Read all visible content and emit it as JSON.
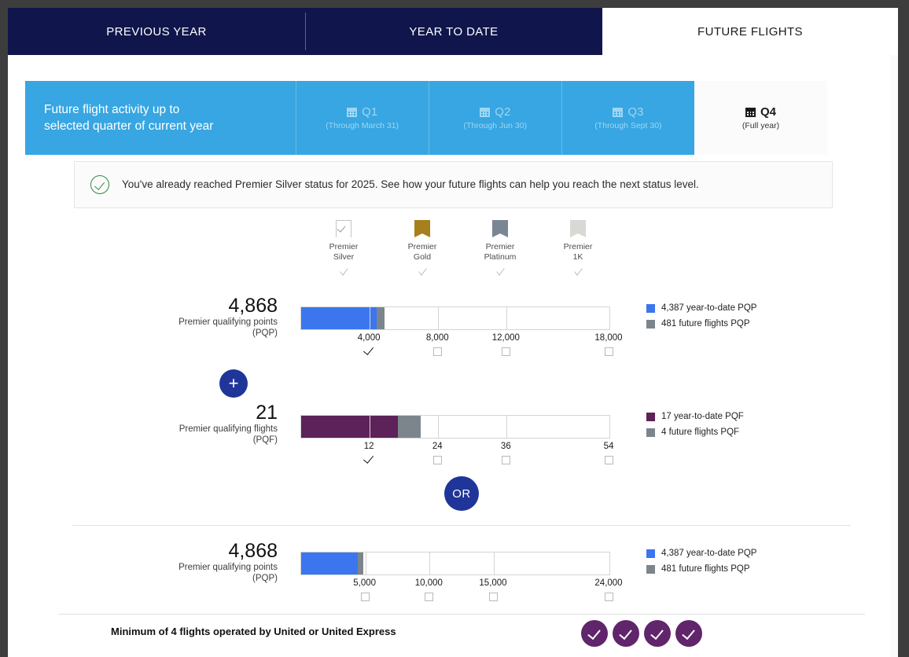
{
  "tabs": [
    {
      "label": "PREVIOUS YEAR",
      "active": false
    },
    {
      "label": "YEAR TO DATE",
      "active": false
    },
    {
      "label": "FUTURE FLIGHTS",
      "active": true
    }
  ],
  "quarter_selector": {
    "intro_line1": "Future flight activity up to",
    "intro_line2": "selected quarter of current year",
    "quarters": [
      {
        "label": "Q1",
        "sub": "(Through March 31)",
        "selected": false,
        "icon": "calendar-icon"
      },
      {
        "label": "Q2",
        "sub": "(Through Jun 30)",
        "selected": false,
        "icon": "calendar-icon"
      },
      {
        "label": "Q3",
        "sub": "(Through Sept 30)",
        "selected": false,
        "icon": "calendar-icon"
      },
      {
        "label": "Q4",
        "sub": "(Full year)",
        "selected": true,
        "icon": "calendar-icon"
      }
    ]
  },
  "notice": {
    "icon": "check-circle-icon",
    "text": "You've already reached Premier Silver status for 2025. See how your future flights can help you reach the next status level."
  },
  "tiers": [
    {
      "line1": "Premier",
      "line2": "Silver",
      "color": "#ffffff",
      "style": "outline-check",
      "icon": "ribbon-icon"
    },
    {
      "line1": "Premier",
      "line2": "Gold",
      "color": "#a5801c",
      "style": "solid",
      "icon": "ribbon-icon"
    },
    {
      "line1": "Premier",
      "line2": "Platinum",
      "color": "#7b8694",
      "style": "solid",
      "icon": "ribbon-icon"
    },
    {
      "line1": "Premier",
      "line2": "1K",
      "color": "#d8d8d5",
      "style": "solid",
      "icon": "ribbon-icon"
    }
  ],
  "colors": {
    "pqp_ytd": "#3b76ee",
    "pqp_future": "#7d858c",
    "pqf_ytd": "#5c2259",
    "pqf_future": "#7d858c",
    "accent_navy": "#10164b",
    "accent_blue": "#37a6e2",
    "button_blue": "#1f3599",
    "purple_dot": "#60256a"
  },
  "plus_button_label": "+",
  "or_button_label": "OR",
  "metrics": [
    {
      "id": "pqp-primary",
      "value": "4,868",
      "caption_line1": "Premier qualifying points",
      "caption_line2": "(PQP)",
      "ticks": [
        {
          "label": "4,000",
          "checked": true
        },
        {
          "label": "8,000",
          "checked": false
        },
        {
          "label": "12,000",
          "checked": false
        },
        {
          "label": "18,000",
          "checked": false
        }
      ],
      "legend": [
        {
          "text": "4,387 year-to-date PQP",
          "color": "#3b76ee"
        },
        {
          "text": "481 future flights PQP",
          "color": "#7d858c"
        }
      ]
    },
    {
      "id": "pqf",
      "value": "21",
      "caption_line1": "Premier qualifying flights",
      "caption_line2": "(PQF)",
      "ticks": [
        {
          "label": "12",
          "checked": true
        },
        {
          "label": "24",
          "checked": false
        },
        {
          "label": "36",
          "checked": false
        },
        {
          "label": "54",
          "checked": false
        }
      ],
      "legend": [
        {
          "text": "17 year-to-date PQF",
          "color": "#5c2259"
        },
        {
          "text": "4 future flights PQF",
          "color": "#7d858c"
        }
      ]
    },
    {
      "id": "pqp-alternate",
      "value": "4,868",
      "caption_line1": "Premier qualifying points",
      "caption_line2": "(PQP)",
      "ticks": [
        {
          "label": "5,000",
          "checked": false
        },
        {
          "label": "10,000",
          "checked": false
        },
        {
          "label": "15,000",
          "checked": false
        },
        {
          "label": "24,000",
          "checked": false
        }
      ],
      "legend": [
        {
          "text": "4,387 year-to-date PQP",
          "color": "#3b76ee"
        },
        {
          "text": "481 future flights PQP",
          "color": "#7d858c"
        }
      ]
    }
  ],
  "footer": {
    "min_flights_text": "Minimum of 4 flights operated by United or United Express",
    "completed_dots": 4
  },
  "chart_data": [
    {
      "type": "bar",
      "title": "Premier qualifying points (PQP)",
      "orientation": "horizontal-stacked",
      "total": 4868,
      "series": [
        {
          "name": "year-to-date PQP",
          "value": 4387,
          "color": "#3b76ee"
        },
        {
          "name": "future flights PQP",
          "value": 481,
          "color": "#7d858c"
        }
      ],
      "tick_values": [
        4000,
        8000,
        12000,
        18000
      ],
      "tick_labels": [
        "4,000",
        "8,000",
        "12,000",
        "18,000"
      ],
      "tick_checked": [
        true,
        false,
        false,
        false
      ],
      "xlim": [
        0,
        18000
      ],
      "grid": true,
      "legend_position": "right"
    },
    {
      "type": "bar",
      "title": "Premier qualifying flights (PQF)",
      "orientation": "horizontal-stacked",
      "total": 21,
      "series": [
        {
          "name": "year-to-date PQF",
          "value": 17,
          "color": "#5c2259"
        },
        {
          "name": "future flights PQF",
          "value": 4,
          "color": "#7d858c"
        }
      ],
      "tick_values": [
        12,
        24,
        36,
        54
      ],
      "tick_labels": [
        "12",
        "24",
        "36",
        "54"
      ],
      "tick_checked": [
        true,
        false,
        false,
        false
      ],
      "xlim": [
        0,
        54
      ],
      "grid": true,
      "legend_position": "right"
    },
    {
      "type": "bar",
      "title": "Premier qualifying points (PQP)",
      "orientation": "horizontal-stacked",
      "total": 4868,
      "series": [
        {
          "name": "year-to-date PQP",
          "value": 4387,
          "color": "#3b76ee"
        },
        {
          "name": "future flights PQP",
          "value": 481,
          "color": "#7d858c"
        }
      ],
      "tick_values": [
        5000,
        10000,
        15000,
        24000
      ],
      "tick_labels": [
        "5,000",
        "10,000",
        "15,000",
        "24,000"
      ],
      "tick_checked": [
        false,
        false,
        false,
        false
      ],
      "xlim": [
        0,
        24000
      ],
      "grid": true,
      "legend_position": "right"
    }
  ]
}
